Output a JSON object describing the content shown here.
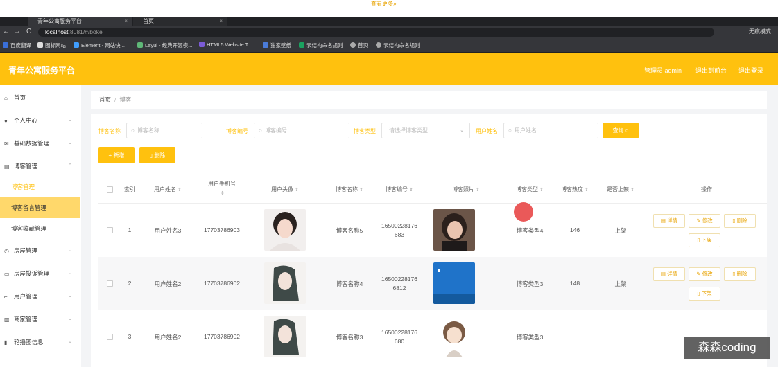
{
  "top_strip": {
    "more_label": "查看更多»"
  },
  "browser": {
    "tabs": [
      {
        "label": "青年公寓服务平台",
        "close": "×"
      },
      {
        "label": "首页",
        "close": "×"
      },
      {
        "label": "+",
        "close": ""
      }
    ],
    "nav": {
      "back": "←",
      "forward": "→",
      "reload": "C"
    },
    "url_host": "localhost",
    "url_path": ":8081/#/boke",
    "right_label": "无痕模式",
    "bookmarks": [
      {
        "label": "百度翻译",
        "color": "#3a6fd8"
      },
      {
        "label": "图标网站",
        "color": "#dddddd"
      },
      {
        "label": "Element - 网站快...",
        "color": "#409eff"
      },
      {
        "label": "Layui - 经典开源模...",
        "color": "#5fb878"
      },
      {
        "label": "HTML5 Website T...",
        "color": "#7b5bd6"
      },
      {
        "label": "独家壁纸",
        "color": "#4a7bd8"
      },
      {
        "label": "表结构命名规则",
        "color": "#1aa260"
      },
      {
        "label": "首页",
        "color": "#aaaaaa"
      },
      {
        "label": "表结构命名规则",
        "color": "#aaaaaa"
      }
    ]
  },
  "header": {
    "brand": "青年公寓服务平台",
    "admin": "管理员 admin",
    "back_to_front": "退出到前台",
    "logout": "退出登录",
    "color": "#ffc10e"
  },
  "sidebar": {
    "home": "首页",
    "personal": "个人中心",
    "basic_data": "基础数据管理",
    "blog_mgmt": "博客管理",
    "blog_sub": [
      "博客管理",
      "博客留言管理",
      "博客收藏管理"
    ],
    "house": "房屋管理",
    "house_complaint": "房屋投诉管理",
    "users": "用户管理",
    "merchants": "商家管理",
    "carousel": "轮播图信息"
  },
  "breadcrumb": {
    "home": "首页",
    "sep": "/",
    "current": "博客"
  },
  "filters": {
    "blog_name_label": "博客名称",
    "blog_name_placeholder": "博客名称",
    "blog_no_label": "博客编号",
    "blog_no_placeholder": "博客编号",
    "blog_type_label": "博客类型",
    "blog_type_placeholder": "请选择博客类型",
    "user_name_label": "用户姓名",
    "user_name_placeholder": "用户姓名",
    "search_label": "查询"
  },
  "actions": {
    "add": "新增",
    "delete": "删除"
  },
  "table": {
    "headers": {
      "index": "索引",
      "user_name": "用户姓名",
      "user_phone": "用户手机号",
      "user_avatar": "用户头像",
      "blog_name": "博客名称",
      "blog_no": "博客编号",
      "blog_photo": "博客照片",
      "blog_type": "博客类型",
      "blog_heat": "博客热度",
      "on_shelf": "是否上架",
      "ops": "操作"
    },
    "row_buttons": {
      "detail": "详情",
      "edit": "修改",
      "delete": "删除",
      "offline": "下架"
    },
    "rows": [
      {
        "index": "1",
        "user_name": "用户姓名3",
        "phone": "17703786903",
        "blog_name": "博客名称5",
        "blog_no_1": "16500228176",
        "blog_no_2": "683",
        "blog_type": "博客类型4",
        "heat": "146",
        "shelf": "上架"
      },
      {
        "index": "2",
        "user_name": "用户姓名2",
        "phone": "17703786902",
        "blog_name": "博客名称4",
        "blog_no_1": "16500228176",
        "blog_no_2": "6812",
        "blog_type": "博客类型3",
        "heat": "148",
        "shelf": "上架"
      },
      {
        "index": "3",
        "user_name": "用户姓名2",
        "phone": "17703786902",
        "blog_name": "博客名称3",
        "blog_no_1": "16500228176",
        "blog_no_2": "680",
        "blog_type": "博客类型3",
        "heat": "",
        "shelf": ""
      }
    ]
  },
  "watermark": "森森coding"
}
